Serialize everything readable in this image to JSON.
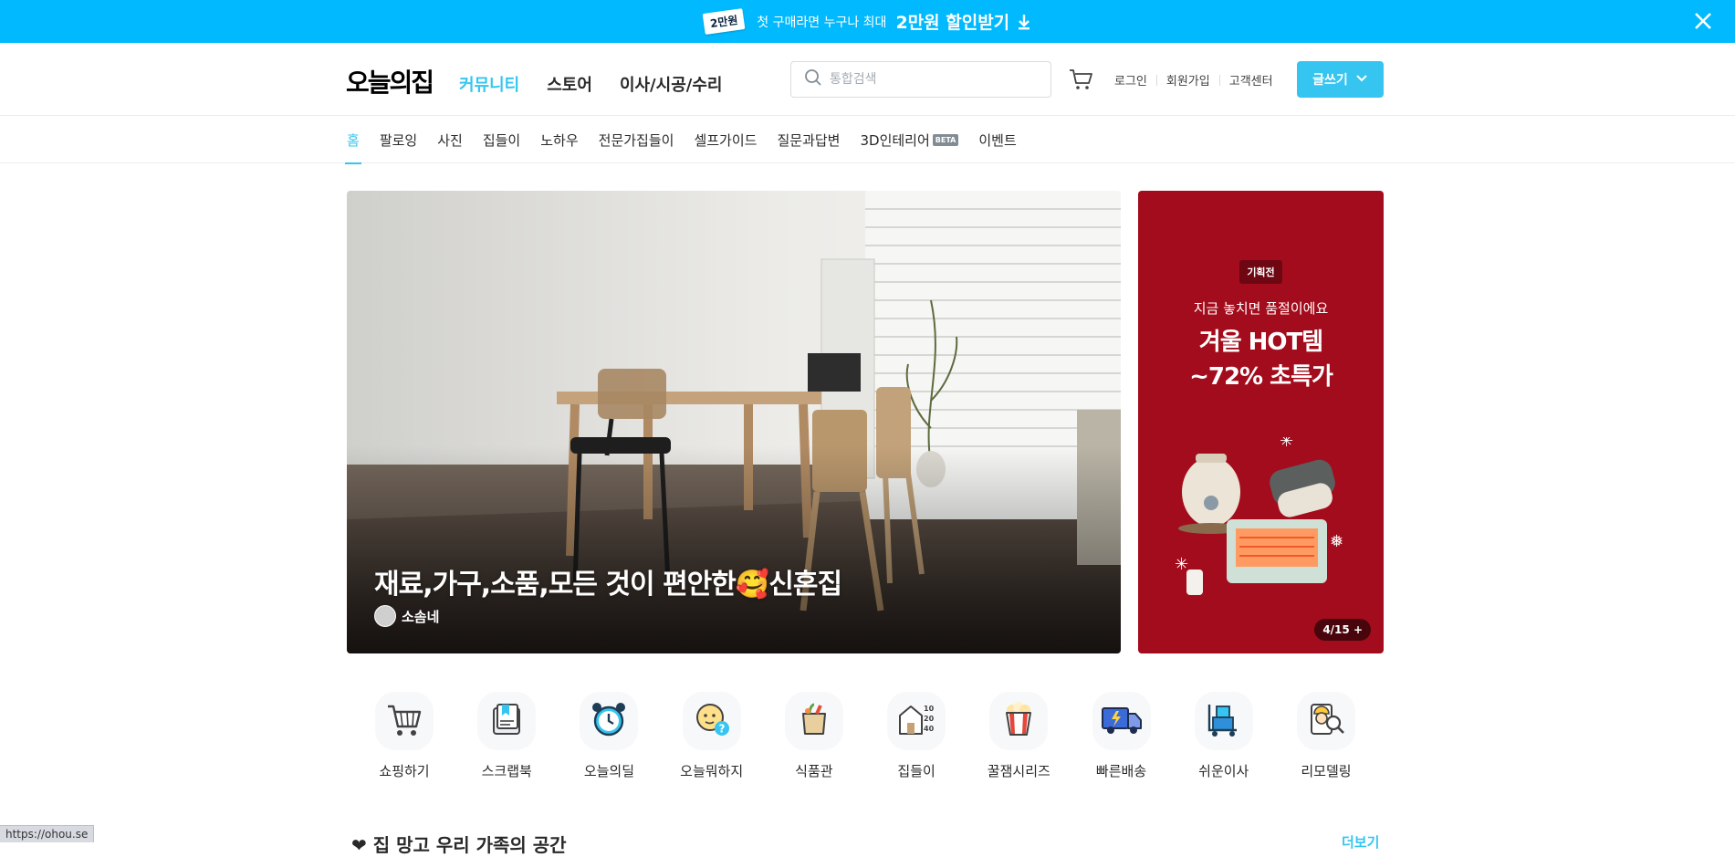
{
  "promo_banner": {
    "tag": "2만원",
    "message": "첫 구매라면 누구나 최대",
    "emphasis": "2만원 할인받기",
    "download_icon": "download-icon",
    "close_icon": "close-icon",
    "bg_color": "#00b9ff"
  },
  "header": {
    "logo": "오늘의집",
    "main_nav": [
      "커뮤니티",
      "스토어",
      "이사/시공/수리"
    ],
    "active_main_nav": "커뮤니티",
    "search": {
      "placeholder": "통합검색",
      "icon": "search-icon"
    },
    "cart_icon": "cart-icon",
    "util": {
      "login": "로그인",
      "signup": "회원가입",
      "support": "고객센터"
    },
    "write_button": "글쓰기",
    "accent_color": "#35c5f0"
  },
  "sub_nav": {
    "items": [
      "홈",
      "팔로잉",
      "사진",
      "집들이",
      "노하우",
      "전문가집들이",
      "셀프가이드",
      "질문과답변",
      "3D인테리어",
      "이벤트"
    ],
    "active": "홈",
    "beta_badge": "BETA"
  },
  "hero": {
    "title": "재료,가구,소품,모든 것이 편안한",
    "title_emoji": "🥰",
    "title_suffix": "신혼집",
    "author": "소솜네"
  },
  "side_ad": {
    "badge": "기획전",
    "subtitle": "지금 놓치면 품절이에요",
    "headline_line1": "겨울 HOT템",
    "headline_line2": "~72% 초특가",
    "counter": "4/15",
    "counter_icon": "plus-icon",
    "bg_color": "#a30c1c"
  },
  "categories": [
    {
      "label": "쇼핑하기",
      "icon": "shopping-cart-icon"
    },
    {
      "label": "스크랩북",
      "icon": "scrapbook-icon"
    },
    {
      "label": "오늘의딜",
      "icon": "alarm-clock-icon"
    },
    {
      "label": "오늘뭐하지",
      "icon": "question-face-icon"
    },
    {
      "label": "식품관",
      "icon": "grocery-bag-icon"
    },
    {
      "label": "집들이",
      "icon": "house-icon"
    },
    {
      "label": "꿀잼시리즈",
      "icon": "popcorn-icon"
    },
    {
      "label": "빠른배송",
      "icon": "delivery-truck-icon"
    },
    {
      "label": "쉬운이사",
      "icon": "moving-cart-icon"
    },
    {
      "label": "리모델링",
      "icon": "remodeling-worker-icon"
    }
  ],
  "section_peek": {
    "title": "❤ 집 망고 우리 가족의 공간",
    "more": "더보기"
  },
  "status_bar": {
    "url": "https://ohou.se"
  }
}
